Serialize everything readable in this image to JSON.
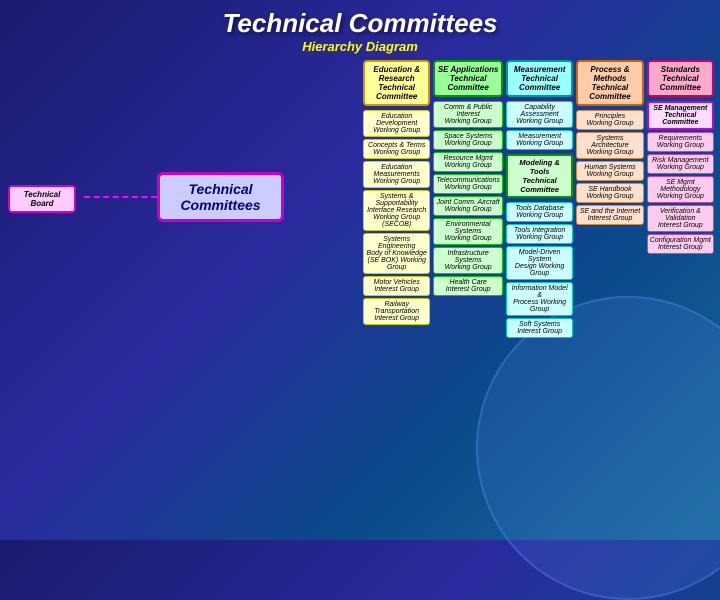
{
  "title": "Technical Committees",
  "subtitle": "Hierarchy Diagram",
  "techBoard": "Technical\nBoard",
  "techCommittees": "Technical\nCommittees",
  "columns": [
    {
      "id": "col1",
      "header": "Education & Research\nTechnical Committee",
      "headerClass": "yellow",
      "items": [
        {
          "text": "Education Development\nWorking Group",
          "cls": "yellow-bg"
        },
        {
          "text": "Concepts & Terms\nWorking Group",
          "cls": "yellow-bg"
        },
        {
          "text": "Education Measurements\nWorking Group",
          "cls": "yellow-bg"
        },
        {
          "text": "Systems & Supportability\nInterface Research\nWorking Group (SECOB)",
          "cls": "yellow-bg"
        },
        {
          "text": "Systems Engineering\nBody of Knowledge\n(SE BOK) Working Group",
          "cls": "yellow-bg"
        },
        {
          "text": "Motor Vehicles\nInterest Group",
          "cls": "yellow-bg"
        },
        {
          "text": "Railway Transportation\nInterest Group",
          "cls": "yellow-bg"
        }
      ]
    },
    {
      "id": "col2",
      "header": "SE Applications\nTechnical Committee",
      "headerClass": "green",
      "items": [
        {
          "text": "Comm & Public Interest\nWorking Group",
          "cls": "green-bg"
        },
        {
          "text": "Space Systems\nWorking Group",
          "cls": "green-bg"
        },
        {
          "text": "Resource Mgmt\nWorking Group",
          "cls": "green-bg"
        },
        {
          "text": "Telecommunications\nWorking Group",
          "cls": "green-bg"
        },
        {
          "text": "Joint Comm. Aircraft\nWorking Group",
          "cls": "green-bg"
        },
        {
          "text": "Environmental Systems\nWorking Group",
          "cls": "green-bg"
        },
        {
          "text": "Infrastructure Systems\nWorking Group",
          "cls": "green-bg"
        },
        {
          "text": "Health Care\nInterest Group",
          "cls": "green-bg"
        }
      ]
    },
    {
      "id": "col3",
      "header": "Measurement\nTechnical Committee",
      "headerClass": "cyan",
      "items": [
        {
          "text": "Capability Assessment\nWorking Group",
          "cls": "cyan-bg"
        },
        {
          "text": "Measurement\nWorking Group",
          "cls": "cyan-bg"
        },
        {
          "text": "Modeling & Tools\nTechnical Committee",
          "cls": "modeling",
          "special": true
        },
        {
          "text": "Tools Database\nWorking Group",
          "cls": "cyan-bg"
        },
        {
          "text": "Tools Integration\nWorking Group",
          "cls": "cyan-bg"
        },
        {
          "text": "Model-Driven System\nDesign Working Group",
          "cls": "cyan-bg"
        },
        {
          "text": "Information Model &\nProcess Working Group",
          "cls": "cyan-bg"
        },
        {
          "text": "Soft Systems\nInterest Group",
          "cls": "cyan-bg"
        }
      ]
    },
    {
      "id": "col4",
      "header": "Process & Methods\nTechnical Committee",
      "headerClass": "peach",
      "items": [
        {
          "text": "Principles\nWorking Group",
          "cls": "peach-bg"
        },
        {
          "text": "Systems Architecture\nWorking Group",
          "cls": "peach-bg"
        },
        {
          "text": "Human Systems\nWorking Group",
          "cls": "peach-bg"
        },
        {
          "text": "SE Handbook\nWorking Group",
          "cls": "peach-bg"
        },
        {
          "text": "SE and the Internet\nInterest Group",
          "cls": "peach-bg"
        }
      ]
    },
    {
      "id": "col5",
      "header": "Standards\nTechnical Committee",
      "headerClass": "pink",
      "items": [
        {
          "text": "SE Management\nTechnical Committee",
          "cls": "se-mgmt",
          "special": true
        },
        {
          "text": "Requirements\nWorking Group",
          "cls": "pink-bg"
        },
        {
          "text": "Risk Management\nWorking Group",
          "cls": "pink-bg"
        },
        {
          "text": "SE Mgmt Methodology\nWorking Group",
          "cls": "pink-bg"
        },
        {
          "text": "Verification & Validation\nInterest Group",
          "cls": "pink-bg"
        },
        {
          "text": "Configuration Mgmt\nInterest Group",
          "cls": "pink-bg"
        }
      ]
    }
  ]
}
